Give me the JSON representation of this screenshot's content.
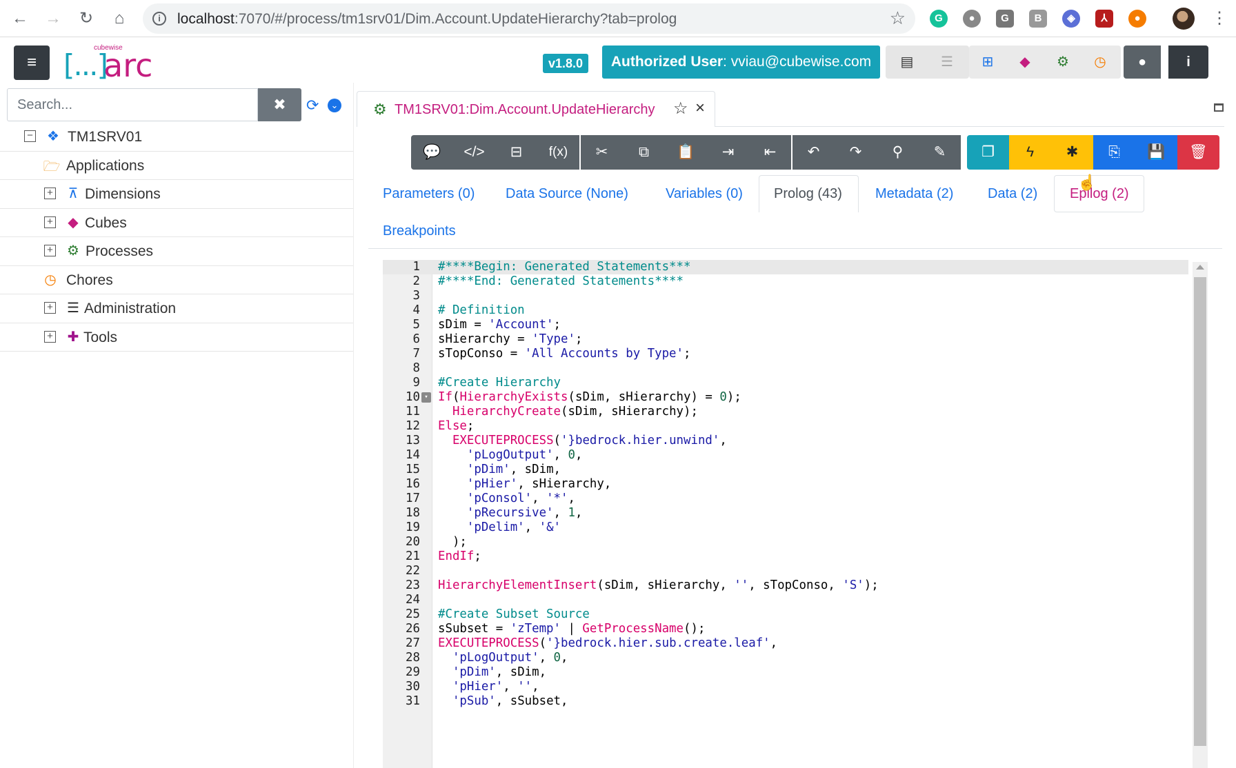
{
  "browser": {
    "url_host": "localhost",
    "url_path": ":7070/#/process/tm1srv01/Dim.Account.UpdateHierarchy?tab=prolog"
  },
  "header": {
    "version": "v1.8.0",
    "auth_label": "Authorized User",
    "auth_user": ": vviau@cubewise.com",
    "logo_sub": "cubewise",
    "logo_brackets": "[...]",
    "logo_text": "arc"
  },
  "sidebar": {
    "search_placeholder": "Search...",
    "items": [
      {
        "label": "TM1SRV01",
        "icon": "server-icon",
        "toggle": "−"
      },
      {
        "label": "Applications",
        "icon": "folder-icon",
        "toggle": ""
      },
      {
        "label": "Dimensions",
        "icon": "hierarchy-icon",
        "toggle": "+"
      },
      {
        "label": "Cubes",
        "icon": "cube-icon",
        "toggle": "+"
      },
      {
        "label": "Processes",
        "icon": "gears-icon",
        "toggle": "+"
      },
      {
        "label": "Chores",
        "icon": "clock-icon",
        "toggle": ""
      },
      {
        "label": "Administration",
        "icon": "server-rack-icon",
        "toggle": "+"
      },
      {
        "label": "Tools",
        "icon": "puzzle-icon",
        "toggle": "+"
      }
    ]
  },
  "editor_tab": {
    "title": "TM1SRV01:Dim.Account.UpdateHierarchy"
  },
  "toolbar": {
    "fx_label": "f(x)"
  },
  "process_tabs": {
    "parameters": "Parameters (0)",
    "data_source": "Data Source  (None)",
    "variables": "Variables (0)",
    "prolog": "Prolog (43)",
    "metadata": "Metadata (2)",
    "data": "Data (2)",
    "epilog": "Epilog (2)",
    "breakpoints": "Breakpoints"
  },
  "code": {
    "language": "TurboIntegrator",
    "lines": [
      "#****Begin: Generated Statements***",
      "#****End: Generated Statements****",
      "",
      "# Definition",
      "sDim = 'Account';",
      "sHierarchy = 'Type';",
      "sTopConso = 'All Accounts by Type';",
      "",
      "#Create Hierarchy",
      "If(HierarchyExists(sDim, sHierarchy) = 0);",
      "  HierarchyCreate(sDim, sHierarchy);",
      "Else;",
      "  EXECUTEPROCESS('}bedrock.hier.unwind',",
      "    'pLogOutput', 0,",
      "    'pDim', sDim,",
      "    'pHier', sHierarchy,",
      "    'pConsol', '*',",
      "    'pRecursive', 1,",
      "    'pDelim', '&'",
      "  );",
      "EndIf;",
      "",
      "HierarchyElementInsert(sDim, sHierarchy, '', sTopConso, 'S');",
      "",
      "#Create Subset Source",
      "sSubset = 'zTemp' | GetProcessName();",
      "EXECUTEPROCESS('}bedrock.hier.sub.create.leaf',",
      "  'pLogOutput', 0,",
      "  'pDim', sDim,",
      "  'pHier', '',",
      "  'pSub', sSubset,"
    ]
  }
}
